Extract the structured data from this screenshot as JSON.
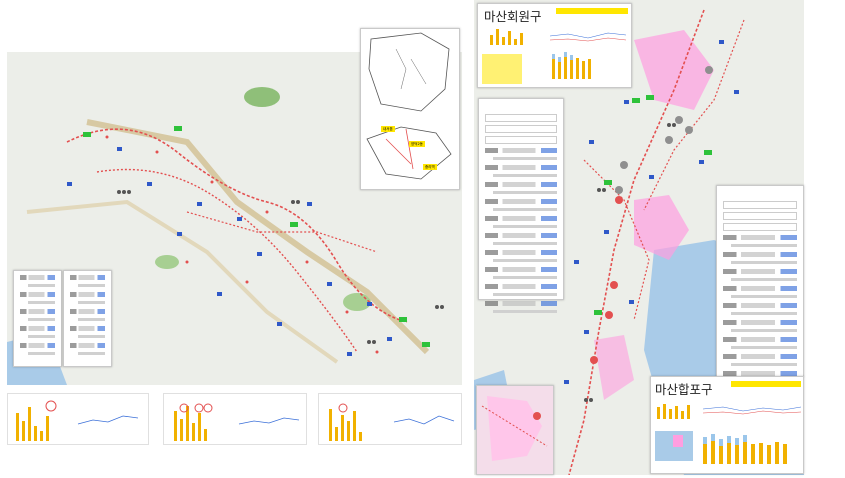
{
  "districts": {
    "hoewon": {
      "title": "마산회원구"
    },
    "happo": {
      "title": "마산합포구"
    }
  },
  "inset_map": {
    "labels": [
      "내서읍",
      "양덕2동",
      "중리역"
    ]
  },
  "colors": {
    "route": "#e35050",
    "park": "#8fbf79",
    "water": "#a9cbe8",
    "highlight": "#ff9ee0",
    "legend_yellow": "#ffe600",
    "bar": "#f1b100",
    "link_blue": "#3a6fd8"
  },
  "icons": [
    "bus-stop-icon",
    "person-group-icon",
    "numbered-circle-icon",
    "station-marker-icon"
  ]
}
